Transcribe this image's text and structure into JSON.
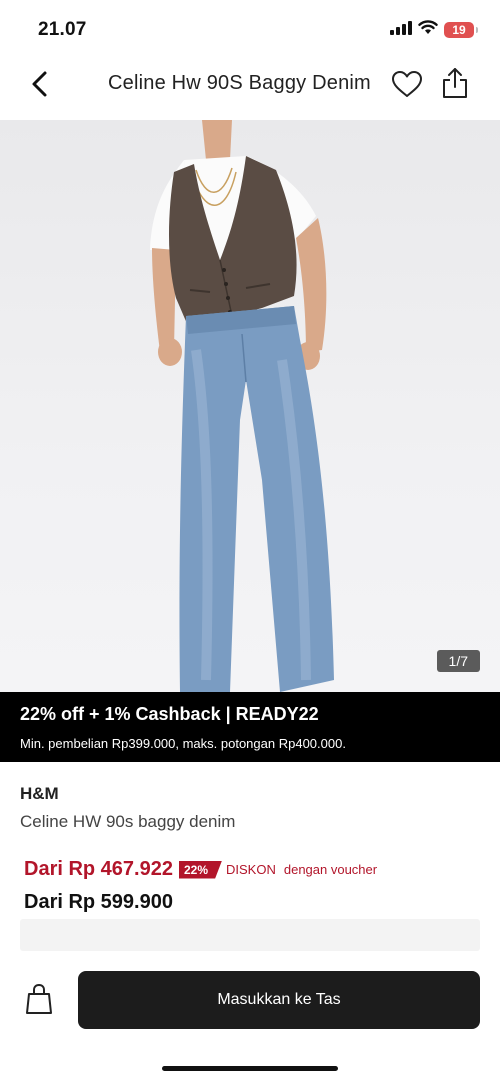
{
  "status_bar": {
    "time": "21.07",
    "battery_level": "19",
    "icons": [
      "cellular-signal-icon",
      "wifi-icon",
      "battery-icon"
    ]
  },
  "header": {
    "title": "Celine Hw 90S Baggy Denim",
    "icons": [
      "chevron-left-icon",
      "heart-icon",
      "share-icon"
    ]
  },
  "gallery": {
    "counter": "1/7"
  },
  "promo": {
    "title": "22% off + 1% Cashback | READY22",
    "terms": "Min. pembelian  Rp399.000, maks. potongan Rp400.000."
  },
  "product": {
    "brand": "H&M",
    "name": "Celine HW 90s baggy denim",
    "sale_price": "Dari Rp 467.922",
    "discount_badge": "22%",
    "discount_label": "DISKON",
    "voucher_label": "dengan voucher",
    "regular_price": "Dari Rp 599.900"
  },
  "actions": {
    "add_to_bag_label": "Masukkan ke Tas",
    "bag_icon": "shopping-bag-icon"
  },
  "colors": {
    "accent_red": "#b2152a",
    "banner_bg": "#000000",
    "button_bg": "#1c1c1c"
  }
}
